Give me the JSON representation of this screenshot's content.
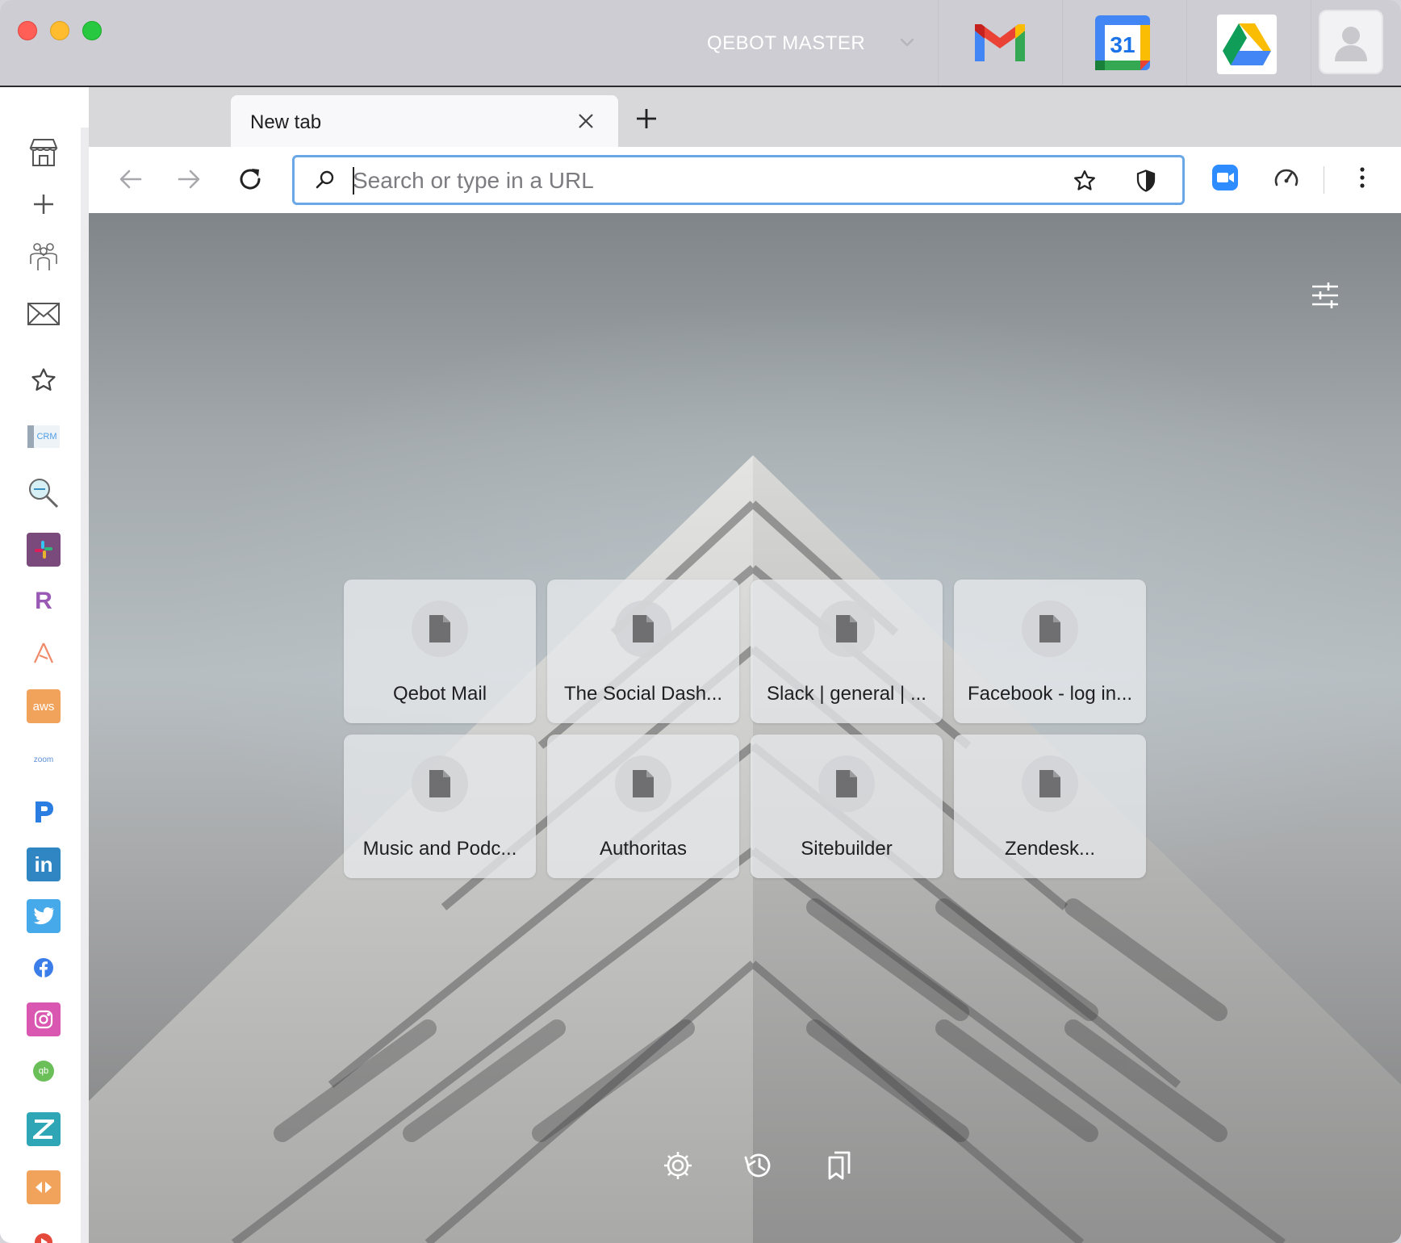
{
  "titlebar": {
    "workspace": "QEBOT MASTER",
    "apps": [
      "gmail-icon",
      "google-calendar-icon",
      "google-drive-icon"
    ],
    "calendar_day": "31"
  },
  "sidebar": {
    "items": [
      "store-icon",
      "add-icon",
      "team-icon",
      "mail-icon",
      "star-icon",
      "crm-icon",
      "search-tool-icon",
      "slack-icon",
      "r-app-icon",
      "triangle-app-icon",
      "aws-icon",
      "zoom-icon",
      "p-app-icon",
      "linkedin-icon",
      "twitter-icon",
      "facebook-icon",
      "instagram-icon",
      "quickbooks-icon",
      "zendesk-icon",
      "app-icon",
      "youtube-icon"
    ],
    "crm_label": "CRM",
    "aws_label": "aws",
    "zoom_label": "zoom",
    "linkedin_label": "in",
    "r_label": "R",
    "qb_label": "qb"
  },
  "tabs": [
    {
      "label": "New tab",
      "active": true
    }
  ],
  "url_bar": {
    "placeholder": "Search or type in a URL",
    "value": ""
  },
  "speed_dials": [
    {
      "title": "Qebot Mail"
    },
    {
      "title": "The Social Dash..."
    },
    {
      "title": "Slack | general | ..."
    },
    {
      "title": "Facebook - log in..."
    },
    {
      "title": "Music and Podc..."
    },
    {
      "title": "Authoritas"
    },
    {
      "title": "Sitebuilder"
    },
    {
      "title": "Zendesk..."
    }
  ],
  "colors": {
    "accent_focus": "#6aa7e6",
    "traffic_red": "#ff5f57",
    "traffic_yellow": "#febc2e",
    "traffic_green": "#28c840"
  }
}
